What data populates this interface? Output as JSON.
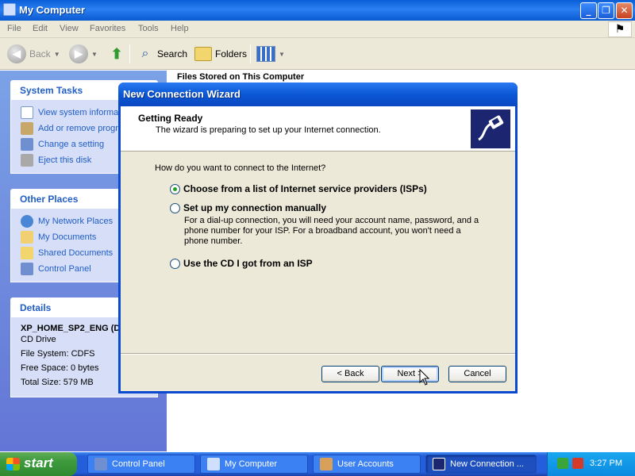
{
  "window": {
    "title": "My Computer"
  },
  "menu": [
    "File",
    "Edit",
    "View",
    "Favorites",
    "Tools",
    "Help"
  ],
  "toolbar": {
    "back": "Back",
    "search": "Search",
    "folders": "Folders"
  },
  "system_tasks": {
    "title": "System Tasks",
    "items": [
      "View system informat",
      "Add or remove progr",
      "Change a setting",
      "Eject this disk"
    ]
  },
  "other_places": {
    "title": "Other Places",
    "items": [
      "My Network Places",
      "My Documents",
      "Shared Documents",
      "Control Panel"
    ]
  },
  "details": {
    "title": "Details",
    "name": "XP_HOME_SP2_ENG (D",
    "type": "CD Drive",
    "file_system": "File System: CDFS",
    "free_space": "Free Space: 0 bytes",
    "total_size": "Total Size: 579 MB"
  },
  "main": {
    "section_heading": "Files Stored on This Computer"
  },
  "wizard": {
    "title": "New Connection Wizard",
    "header_title": "Getting Ready",
    "header_subtitle": "The wizard is preparing to set up your Internet connection.",
    "question": "How do you want to connect to the Internet?",
    "options": [
      "Choose from a list of Internet service providers (ISPs)",
      "Set up my connection manually",
      "Use the CD I got from an ISP"
    ],
    "selected_option": 0,
    "manual_description": "For a dial-up connection, you will need your account name, password, and a phone number for your ISP. For a broadband account, you won't need a phone number.",
    "buttons": {
      "back": "< Back",
      "next": "Next >",
      "cancel": "Cancel"
    }
  },
  "taskbar": {
    "start": "start",
    "tasks": [
      "Control Panel",
      "My Computer",
      "User Accounts",
      "New Connection ..."
    ],
    "clock": "3:27 PM"
  }
}
